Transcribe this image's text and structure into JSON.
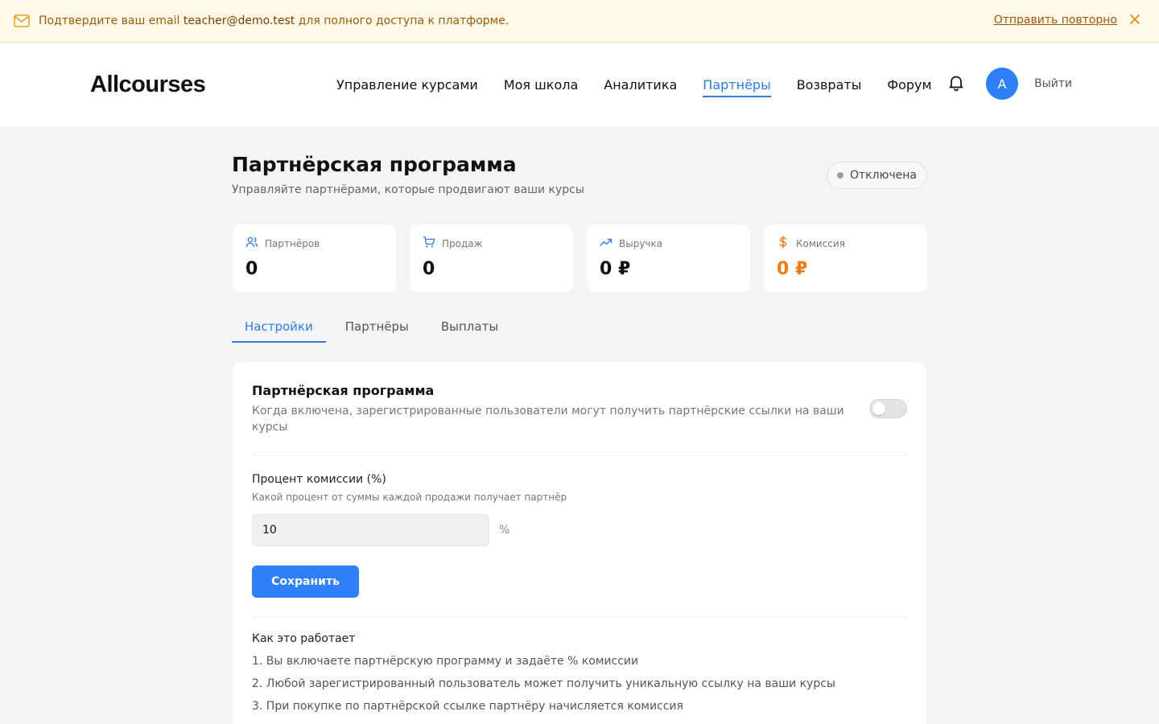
{
  "banner": {
    "message_prefix": "Подтвердите ваш email ",
    "email": "teacher@demo.test",
    "message_suffix": " для полного доступа к платформе.",
    "resend_label": "Отправить повторно",
    "icon": "mail-icon",
    "accent_color": "#f0a020"
  },
  "header": {
    "logo": "Allcourses",
    "nav": [
      {
        "label": "Управление курсами",
        "active": false
      },
      {
        "label": "Моя школа",
        "active": false
      },
      {
        "label": "Аналитика",
        "active": false
      },
      {
        "label": "Партнёры",
        "active": true
      },
      {
        "label": "Возвраты",
        "active": false
      },
      {
        "label": "Форум",
        "active": false
      }
    ],
    "avatar_letter": "A",
    "logout_label": "Выйти",
    "accent_color": "#2d7be0"
  },
  "page": {
    "title": "Партнёрская программа",
    "subtitle": "Управляйте партнёрами, которые продвигают ваши курсы",
    "status": "Отключена"
  },
  "stats": [
    {
      "label": "Партнёров",
      "value": "0",
      "icon": "users-icon"
    },
    {
      "label": "Продаж",
      "value": "0",
      "icon": "cart-icon"
    },
    {
      "label": "Выручка",
      "value": "0 ₽",
      "icon": "trend-up-icon"
    },
    {
      "label": "Комиссия",
      "value": "0 ₽",
      "icon": "dollar-icon",
      "color": "#f07a14"
    }
  ],
  "tabs": [
    {
      "label": "Настройки",
      "active": true
    },
    {
      "label": "Партнёры",
      "active": false
    },
    {
      "label": "Выплаты",
      "active": false
    }
  ],
  "settings": {
    "program_title": "Партнёрская программа",
    "program_description": "Когда включена, зарегистрированные пользователи могут получить партнёрские ссылки на ваши курсы",
    "program_enabled": false,
    "commission_label": "Процент комиссии (%)",
    "commission_hint": "Какой процент от суммы каждой продажи получает партнёр",
    "commission_value": "10",
    "commission_unit": "%",
    "save_label": "Сохранить",
    "how_title": "Как это работает",
    "how_items": [
      "1. Вы включаете партнёрскую программу и задаёте % комиссии",
      "2. Любой зарегистрированный пользователь может получить уникальную ссылку на ваши курсы",
      "3. При покупке по партнёрской ссылке партнёру начисляется комиссия"
    ]
  }
}
